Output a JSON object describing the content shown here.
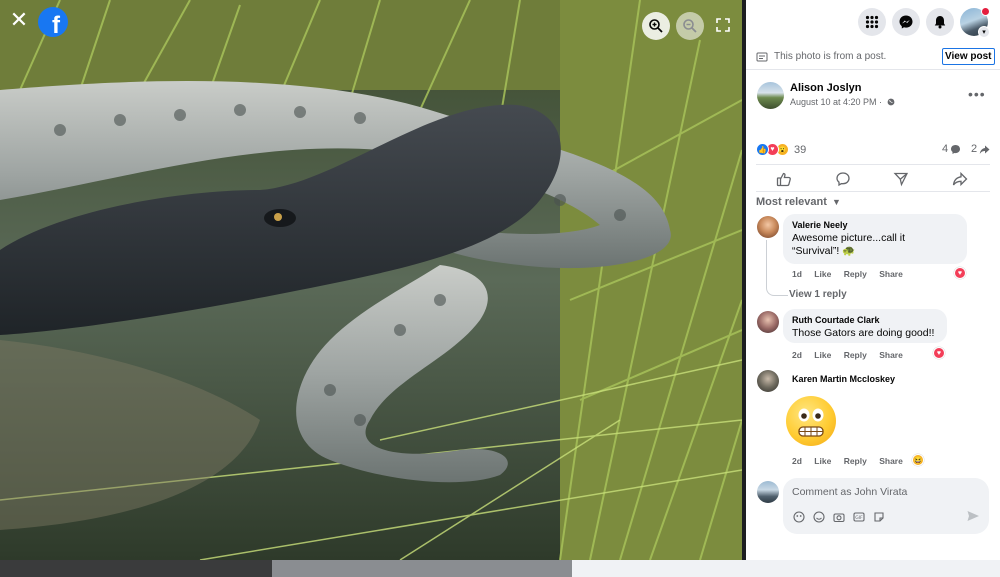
{
  "viewer": {
    "close_icon": "close-icon",
    "logo_letter": "f",
    "zoom_in_icon": "zoom-in-icon",
    "zoom_out_icon": "zoom-out-icon",
    "fullscreen_icon": "expand-icon"
  },
  "topbar": {
    "menu_icon": "grid-menu-icon",
    "messenger_icon": "messenger-icon",
    "notifications_icon": "bell-icon",
    "account_icon": "account-avatar"
  },
  "post_note": {
    "text": "This photo is from a post.",
    "view_post": "View post"
  },
  "post": {
    "author": "Alison Joslyn",
    "time": "August 10 at 4:20 PM ·",
    "reaction_count": "39",
    "comment_count": "4",
    "share_count": "2"
  },
  "filter": {
    "label": "Most relevant"
  },
  "comments": [
    {
      "name": "Valerie Neely",
      "text_line1": "Awesome picture...call it",
      "text_line2": "“Survival”! 🐢",
      "age": "1d",
      "like": "Like",
      "reply": "Reply",
      "share": "Share",
      "view_replies": "View 1 reply"
    },
    {
      "name": "Ruth Courtade Clark",
      "text": "Those Gators are doing good!!",
      "age": "2d",
      "like": "Like",
      "reply": "Reply",
      "share": "Share"
    },
    {
      "name": "Karen Martin Mccloskey",
      "age": "2d",
      "like": "Like",
      "reply": "Reply",
      "share": "Share"
    }
  ],
  "composer": {
    "placeholder": "Comment as John Virata"
  },
  "colors": {
    "facebook_blue": "#1877f2",
    "love_red": "#f33e58",
    "notification_red": "#e41e3f",
    "text_secondary": "#65676b"
  }
}
